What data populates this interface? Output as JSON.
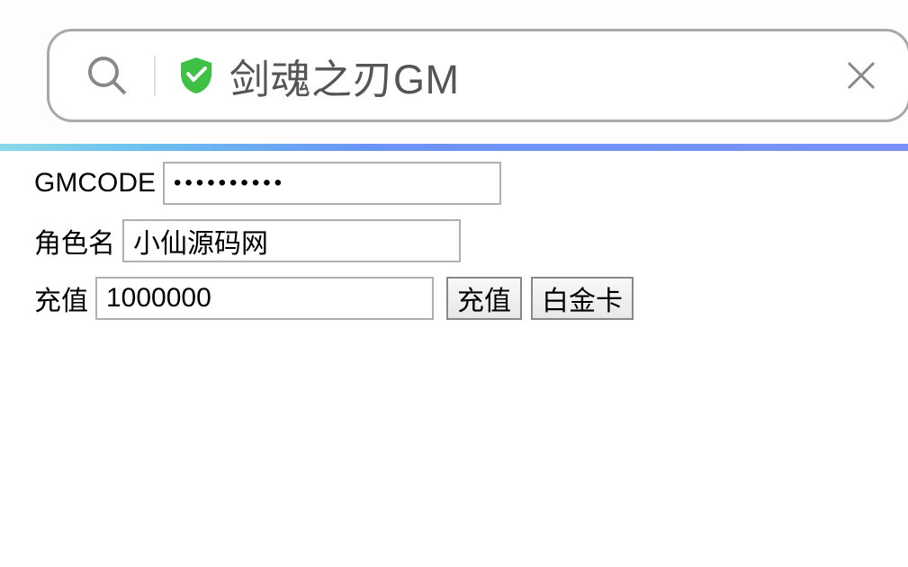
{
  "header": {
    "title": "剑魂之刃GM"
  },
  "form": {
    "gmcode_label": "GMCODE",
    "gmcode_value": "••••••••••",
    "rolename_label": "角色名",
    "rolename_value": "小仙源码网",
    "amount_label": "充值",
    "amount_value": "1000000",
    "recharge_button": "充值",
    "platinum_button": "白金卡"
  }
}
